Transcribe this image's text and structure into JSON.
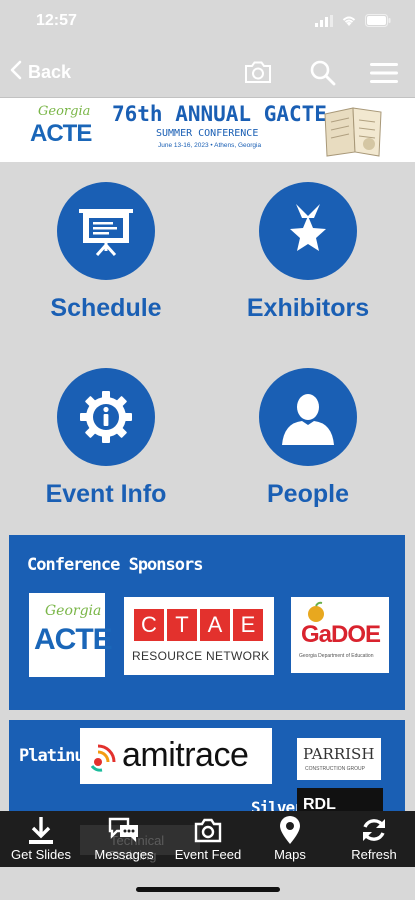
{
  "status": {
    "time": "12:57"
  },
  "nav": {
    "back_label": "Back"
  },
  "banner": {
    "logo_top": "Georgia",
    "logo_main": "ACTE",
    "title": "76th ANNUAL GACTE",
    "subtitle": "SUMMER CONFERENCE",
    "dates": "June 13-16, 2023 • Athens, Georgia"
  },
  "tiles": [
    {
      "label": "Schedule",
      "icon": "presentation-board-icon"
    },
    {
      "label": "Exhibitors",
      "icon": "ribbon-star-icon"
    },
    {
      "label": "Event Info",
      "icon": "info-gear-icon"
    },
    {
      "label": "People",
      "icon": "person-icon"
    }
  ],
  "sponsors": {
    "title": "Conference Sponsors",
    "logos": [
      {
        "name": "Georgia ACTE",
        "top": "Georgia",
        "main": "ACTE"
      },
      {
        "name": "CTAE Resource Network",
        "letters": [
          "C",
          "T",
          "A",
          "E"
        ],
        "sub": "RESOURCE NETWORK"
      },
      {
        "name": "GaDOE",
        "main": "GaDOE",
        "sub": "Georgia Department of Education"
      }
    ]
  },
  "platinum": {
    "label": "Platinum",
    "logo_text": "amitrace",
    "parrish_main": "PARRISH",
    "parrish_sub": "CONSTRUCTION GROUP",
    "silver_label": "Silver",
    "rdl_text": "RDL",
    "partial_text": "Technical Training"
  },
  "tabs": [
    {
      "label": "Get Slides",
      "icon": "download-icon"
    },
    {
      "label": "Messages",
      "icon": "chat-bubbles-icon"
    },
    {
      "label": "Event Feed",
      "icon": "camera-icon"
    },
    {
      "label": "Maps",
      "icon": "map-pin-icon"
    },
    {
      "label": "Refresh",
      "icon": "refresh-icon"
    }
  ],
  "colors": {
    "primary": "#1a5fb4",
    "background": "#d8d8d8",
    "tabbar": "#1e1e1e"
  }
}
